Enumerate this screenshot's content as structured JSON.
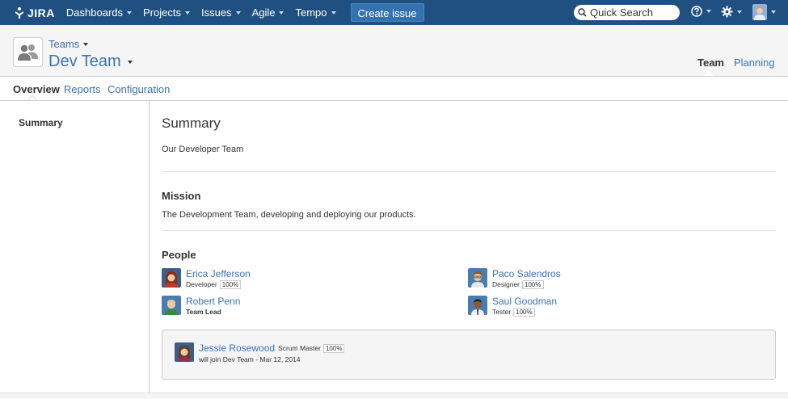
{
  "nav": {
    "logo": "JIRA",
    "items": [
      "Dashboards",
      "Projects",
      "Issues",
      "Agile",
      "Tempo"
    ],
    "create_label": "Create issue",
    "search_placeholder": "Quick Search"
  },
  "header": {
    "breadcrumb": "Teams",
    "title": "Dev Team",
    "tabs": [
      "Team",
      "Planning"
    ]
  },
  "subnav": {
    "tabs": [
      "Overview",
      "Reports",
      "Configuration"
    ]
  },
  "sidebar": {
    "items": [
      "Summary"
    ]
  },
  "main": {
    "summary_heading": "Summary",
    "summary_text": "Our Developer Team",
    "mission_heading": "Mission",
    "mission_text": "The Development Team, developing and deploying our products.",
    "people_heading": "People",
    "people": [
      {
        "name": "Erica Jefferson",
        "role": "Developer",
        "pct": "100%"
      },
      {
        "name": "Paco Salendros",
        "role": "Designer",
        "pct": "100%"
      },
      {
        "name": "Robert Penn",
        "role": "Team Lead",
        "pct": ""
      },
      {
        "name": "Saul Goodman",
        "role": "Tester",
        "pct": "100%"
      }
    ],
    "future": {
      "name": "Jessie Rosewood",
      "role": "Scrum Master",
      "pct": "100%",
      "note": "will join Dev Team - Mar 12, 2014"
    }
  },
  "colors": {
    "nav_bg": "#205081",
    "link": "#3b73af",
    "button": "#3572b0"
  }
}
